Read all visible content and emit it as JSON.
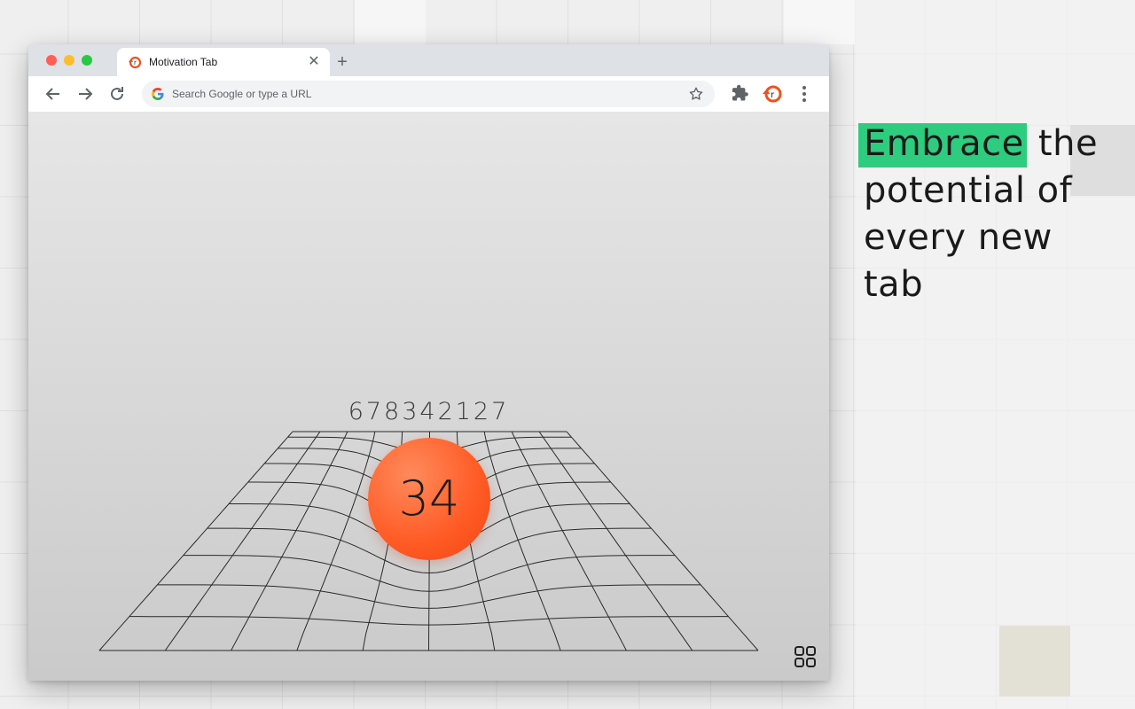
{
  "browser": {
    "tab": {
      "title": "Motivation Tab",
      "favicon": "motivation-tab-logo"
    },
    "omnibox": {
      "placeholder": "Search Google or type a URL"
    },
    "colors": {
      "close": "#ff5f57",
      "minimize": "#febc2e",
      "maximize": "#28c840"
    }
  },
  "page": {
    "counter": "678342127",
    "age": "34",
    "accent": "#ff5a24"
  },
  "promo": {
    "highlight": "Embrace",
    "rest_line1": " the",
    "line2": "potential of",
    "line3": "every new",
    "line4": "tab",
    "highlight_color": "#2ecc7e"
  }
}
